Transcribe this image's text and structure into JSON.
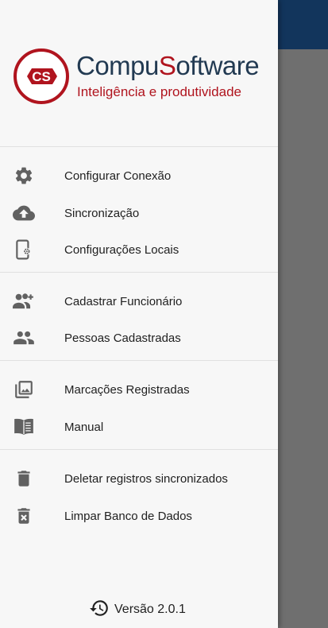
{
  "brand": {
    "badge": "CS",
    "name_part1": "Compu",
    "name_s": "S",
    "name_part2": "oftware",
    "tagline": "Inteligência e produtividade",
    "colors": {
      "navy": "#223a52",
      "red": "#b0141e"
    }
  },
  "menu": {
    "items": [
      {
        "icon": "gear-icon",
        "label": "Configurar Conexão"
      },
      {
        "icon": "cloud-upload-icon",
        "label": "Sincronização"
      },
      {
        "icon": "phone-settings-icon",
        "label": "Configurações Locais"
      },
      {
        "icon": "person-add-icon",
        "label": "Cadastrar Funcionário"
      },
      {
        "icon": "people-icon",
        "label": "Pessoas Cadastradas"
      },
      {
        "icon": "photo-library-icon",
        "label": "Marcações Registradas"
      },
      {
        "icon": "book-icon",
        "label": "Manual"
      },
      {
        "icon": "trash-icon",
        "label": "Deletar registros sincronizados"
      },
      {
        "icon": "delete-forever-icon",
        "label": "Limpar Banco de Dados"
      }
    ]
  },
  "footer": {
    "icon": "history-icon",
    "version": "Versão 2.0.1"
  },
  "colors": {
    "appbar": "#12355c",
    "drawer_bg": "#f7f7f7",
    "icon": "#616161"
  }
}
